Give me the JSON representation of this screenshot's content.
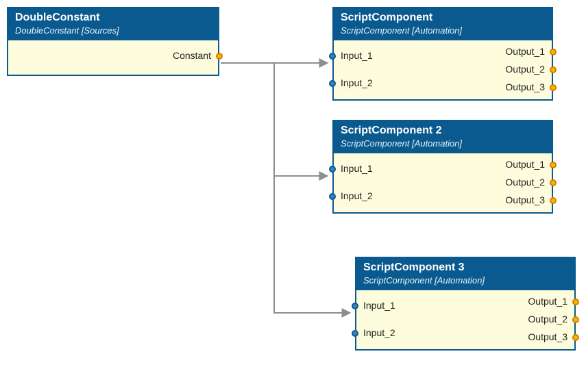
{
  "nodes": {
    "source": {
      "title": "DoubleConstant",
      "subtitle": "DoubleConstant [Sources]",
      "outputs": {
        "constant": "Constant"
      }
    },
    "script1": {
      "title": "ScriptComponent",
      "subtitle": "ScriptComponent [Automation]",
      "inputs": {
        "i1": "Input_1",
        "i2": "Input_2"
      },
      "outputs": {
        "o1": "Output_1",
        "o2": "Output_2",
        "o3": "Output_3"
      }
    },
    "script2": {
      "title": "ScriptComponent 2",
      "subtitle": "ScriptComponent [Automation]",
      "inputs": {
        "i1": "Input_1",
        "i2": "Input_2"
      },
      "outputs": {
        "o1": "Output_1",
        "o2": "Output_2",
        "o3": "Output_3"
      }
    },
    "script3": {
      "title": "ScriptComponent 3",
      "subtitle": "ScriptComponent [Automation]",
      "inputs": {
        "i1": "Input_1",
        "i2": "Input_2"
      },
      "outputs": {
        "o1": "Output_1",
        "o2": "Output_2",
        "o3": "Output_3"
      }
    }
  },
  "colors": {
    "nodeBorder": "#0a5a8f",
    "nodeHeader": "#0a5a8f",
    "nodeBody": "#fdfcdc",
    "wire": "#8a8f94",
    "inputPort": "#3a7fc4",
    "outputPort": "#ffb400"
  },
  "connections": [
    {
      "from": "source.constant",
      "to": "script1.i1"
    },
    {
      "from": "source.constant",
      "to": "script2.i1"
    },
    {
      "from": "source.constant",
      "to": "script3.i1"
    }
  ]
}
